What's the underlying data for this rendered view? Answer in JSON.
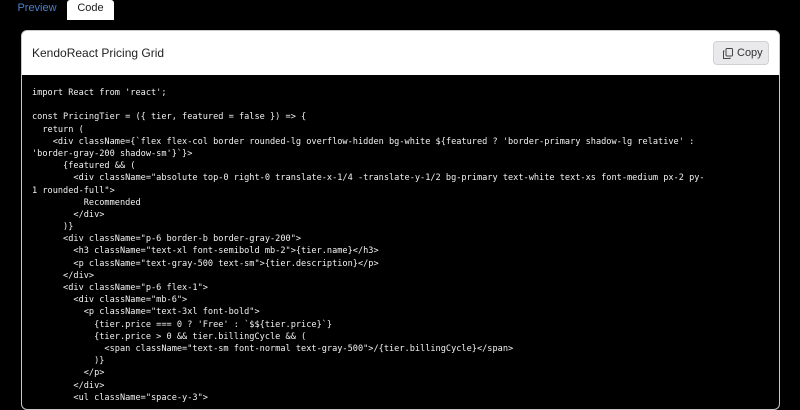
{
  "tabs": [
    {
      "label": "Preview",
      "active": false
    },
    {
      "label": "Code",
      "active": true
    }
  ],
  "panel": {
    "title": "KendoReact Pricing Grid",
    "copy_label": "Copy",
    "copy_icon": "copy-icon"
  },
  "colors": {
    "accent": "#4b80c8",
    "code_background": "#000000",
    "code_text": "#f2f2f2"
  },
  "code": {
    "lines": [
      "import React from 'react';",
      "",
      "const PricingTier = ({ tier, featured = false }) => {",
      "  return (",
      "    <div className={`flex flex-col border rounded-lg overflow-hidden bg-white ${featured ? 'border-primary shadow-lg relative' :",
      "'border-gray-200 shadow-sm'}`}>",
      "      {featured && (",
      "        <div className=\"absolute top-0 right-0 translate-x-1/4 -translate-y-1/2 bg-primary text-white text-xs font-medium px-2 py-",
      "1 rounded-full\">",
      "          Recommended",
      "        </div>",
      "      )}",
      "      <div className=\"p-6 border-b border-gray-200\">",
      "        <h3 className=\"text-xl font-semibold mb-2\">{tier.name}</h3>",
      "        <p className=\"text-gray-500 text-sm\">{tier.description}</p>",
      "      </div>",
      "      <div className=\"p-6 flex-1\">",
      "        <div className=\"mb-6\">",
      "          <p className=\"text-3xl font-bold\">",
      "            {tier.price === 0 ? 'Free' : `$${tier.price}`}",
      "            {tier.price > 0 && tier.billingCycle && (",
      "              <span className=\"text-sm font-normal text-gray-500\">/{tier.billingCycle}</span>",
      "            )}",
      "          </p>",
      "        </div>",
      "        <ul className=\"space-y-3\">"
    ]
  }
}
